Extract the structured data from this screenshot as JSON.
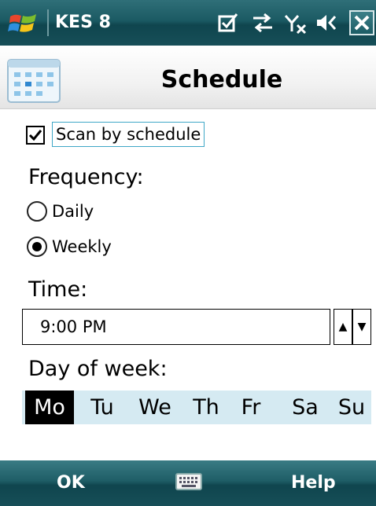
{
  "statusbar": {
    "app_title": "KES 8",
    "icons": [
      "windows-start-icon",
      "task-check-icon",
      "sync-arrows-icon",
      "no-signal-icon",
      "speaker-icon",
      "close-icon"
    ]
  },
  "header": {
    "title": "Schedule",
    "icon": "calendar-icon"
  },
  "scan": {
    "label": "Scan by schedule",
    "checked": true
  },
  "frequency": {
    "title": "Frequency:",
    "options": [
      {
        "label": "Daily",
        "selected": false
      },
      {
        "label": "Weekly",
        "selected": true
      }
    ]
  },
  "time": {
    "title": "Time:",
    "value": "9:00 PM",
    "up": "▲",
    "down": "▼"
  },
  "day_of_week": {
    "title": "Day of week:",
    "days": [
      "Mo",
      "Tu",
      "We",
      "Th",
      "Fr",
      "Sa",
      "Su"
    ],
    "selected": "Mo"
  },
  "softkeys": {
    "left": "OK",
    "center_icon": "keyboard-icon",
    "right": "Help"
  },
  "colors": {
    "bar": "#1b5a63",
    "days_bg": "#d5eaf2",
    "focus_border": "#3fa7c7"
  }
}
